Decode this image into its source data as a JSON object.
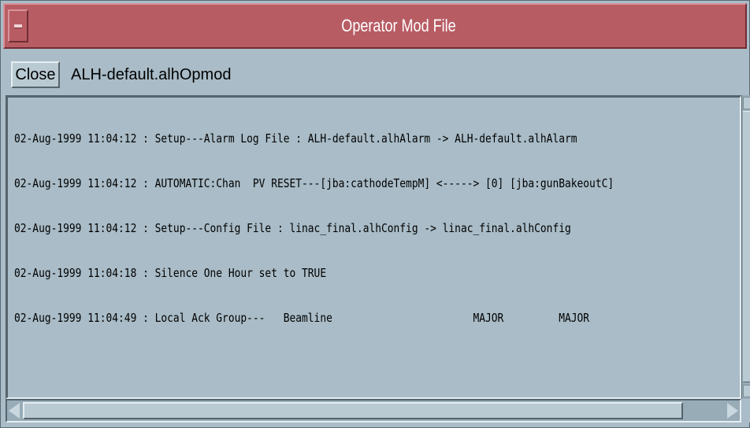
{
  "window": {
    "title": "Operator Mod File"
  },
  "toolbar": {
    "close_label": "Close",
    "file_name": "ALH-default.alhOpmod"
  },
  "log": {
    "lines": [
      "02-Aug-1999 11:04:12 : Setup---Alarm Log File : ALH-default.alhAlarm -> ALH-default.alhAlarm",
      "02-Aug-1999 11:04:12 : AUTOMATIC:Chan  PV RESET---[jba:cathodeTempM] <-----> [0] [jba:gunBakeoutC]",
      "02-Aug-1999 11:04:12 : Setup---Config File : linac_final.alhConfig -> linac_final.alhConfig",
      "02-Aug-1999 11:04:18 : Silence One Hour set to TRUE",
      "02-Aug-1999 11:04:49 : Local Ack Group---   Beamline                       MAJOR         MAJOR"
    ]
  },
  "colors": {
    "title_bar": "#b85c64",
    "window_bg": "#a9bcc7"
  },
  "icons": {
    "window_menu": "window-menu-icon",
    "scroll_left": "arrow-left-icon",
    "scroll_right": "arrow-right-icon"
  }
}
